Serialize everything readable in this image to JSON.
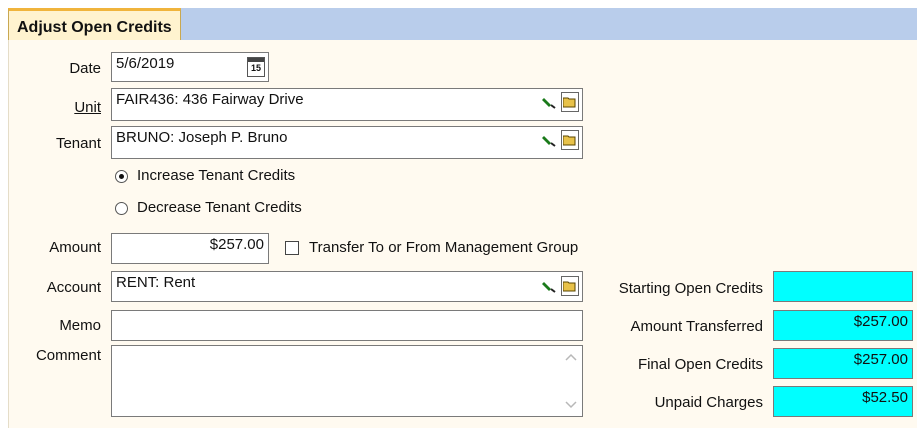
{
  "tab": {
    "title": "Adjust Open Credits"
  },
  "form": {
    "date": {
      "label": "Date",
      "value": "5/6/2019",
      "calendar_text": "15"
    },
    "unit": {
      "label": "Unit",
      "value": "FAIR436: 436 Fairway Drive"
    },
    "tenant": {
      "label": "Tenant",
      "value": "BRUNO: Joseph P. Bruno"
    },
    "increase_label": "Increase Tenant Credits",
    "decrease_label": "Decrease Tenant Credits",
    "amount": {
      "label": "Amount",
      "value": "$257.00"
    },
    "transfer_label": "Transfer To or From Management Group",
    "account": {
      "label": "Account",
      "value": "RENT: Rent"
    },
    "memo": {
      "label": "Memo",
      "value": ""
    },
    "comment": {
      "label": "Comment",
      "value": ""
    }
  },
  "summary": {
    "starting": {
      "label": "Starting Open Credits",
      "value": ""
    },
    "transferred": {
      "label": "Amount Transferred",
      "value": "$257.00"
    },
    "final": {
      "label": "Final Open Credits",
      "value": "$257.00"
    },
    "unpaid": {
      "label": "Unpaid Charges",
      "value": "$52.50"
    }
  },
  "state": {
    "increase_selected": true,
    "transfer_checked": false
  },
  "icons": {
    "lookup": "flashlight-icon",
    "browse": "folder-open-icon",
    "calendar": "calendar-icon"
  },
  "colors": {
    "summary_fill": "#00ffff",
    "tab_fill": "#fff3cf",
    "tab_accent": "#f0b43c",
    "panel_bg": "#fffaf0"
  }
}
